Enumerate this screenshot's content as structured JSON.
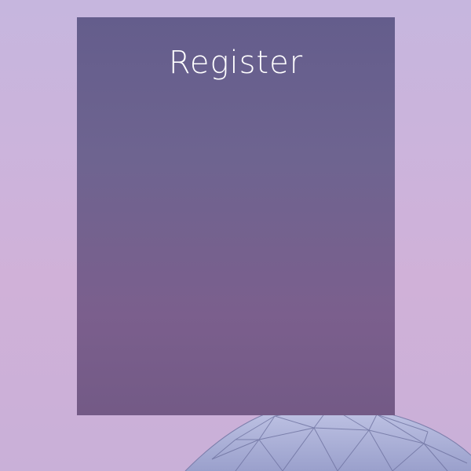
{
  "register": {
    "title": "Register"
  },
  "colors": {
    "background": "#cbb3da",
    "panel": "#6e6490",
    "title": "#ffffff",
    "dome": "#aab0d6"
  },
  "icons": {
    "dome": "geodesic-dome-icon"
  }
}
